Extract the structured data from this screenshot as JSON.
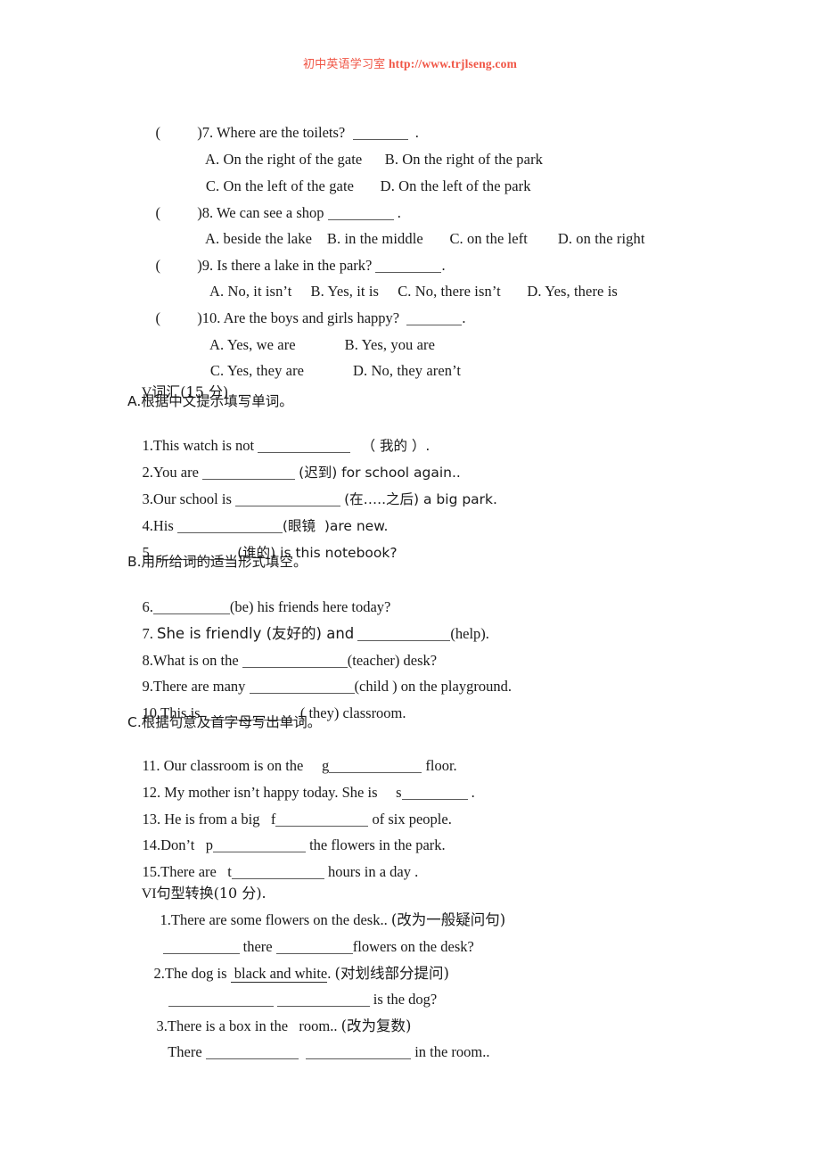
{
  "header": {
    "chinese": "初中英语学习室",
    "url": "http://www.trjlseng.com",
    "color": "#f05545"
  },
  "multiple_choice": [
    {
      "marker": "(          )7.",
      "stem": "Where are the toilets?",
      "options_rows": [
        [
          "A. On the right of the gate",
          "B. On the right of the park"
        ],
        [
          "C. On the left of the gate",
          "D. On the left of the park"
        ]
      ]
    },
    {
      "marker": "(          )8.",
      "stem": "We can see a shop",
      "options_rows": [
        [
          "A. beside the lake",
          "B. in the middle",
          "C. on the left",
          "D. on the right"
        ]
      ]
    },
    {
      "marker": "(          )9.",
      "stem": "Is there a lake in the park?",
      "options_rows": [
        [
          "A. No, it isn’t",
          "B. Yes, it is",
          "C. No, there isn’t",
          "D. Yes, there is"
        ]
      ]
    },
    {
      "marker": "(          )10.",
      "stem": "Are the boys and girls happy?",
      "options_rows": [
        [
          "A. Yes, we are",
          "B. Yes, you are"
        ],
        [
          "C. Yes, they are",
          "D. No, they aren’t"
        ]
      ]
    }
  ],
  "section_v": {
    "heading_roman": "V",
    "heading_cn": "词汇",
    "heading_score": "(15 分)",
    "part_a_heading": "A.根据中文提示填写单词。",
    "part_a_items": [
      {
        "num": "1.",
        "pre": "This watch is not",
        "post": "（ 我的 ）."
      },
      {
        "num": "2.",
        "pre": "You are",
        "post": "(迟到) for school again.."
      },
      {
        "num": "3.",
        "pre": "Our school is",
        "post": "(在…..之后) a big park."
      },
      {
        "num": "4.",
        "pre": "His",
        "post": "(眼镜  )are new."
      },
      {
        "num": "5.",
        "pre": "",
        "post": "(谁的) is this notebook?"
      }
    ],
    "part_b_heading": "B.用所给词的适当形式填空。",
    "part_b_items": [
      {
        "num": "6.",
        "pre": "",
        "post": "(be) his friends here today?"
      },
      {
        "num": "7.",
        "pre": "She is friendly (友好的) and",
        "post": "(help)."
      },
      {
        "num": "8.",
        "pre": "What is on the",
        "post": "(teacher) desk?"
      },
      {
        "num": "9.",
        "pre": "There are many",
        "post": "(child ) on the playground."
      },
      {
        "num": "10.",
        "pre": "This is",
        "post": "( they) classroom."
      }
    ],
    "part_c_heading": "C.根据句意及首字母写出单词。",
    "part_c_items": [
      {
        "num": "11.",
        "pre": "Our classroom is on the",
        "letter": "g",
        "post": "floor."
      },
      {
        "num": "12.",
        "pre": "My mother isn’t happy today. She is",
        "letter": "s",
        "post": "."
      },
      {
        "num": "13.",
        "pre": "He is from a big",
        "letter": "f",
        "post": "of six people."
      },
      {
        "num": "14.",
        "pre": "Don’t",
        "letter": "p",
        "post": "the flowers in the park."
      },
      {
        "num": "15.",
        "pre": "There are",
        "letter": "t",
        "post": "hours in a day ."
      }
    ]
  },
  "section_vi": {
    "heading_roman": "VI",
    "heading_cn": "句型转换",
    "heading_score": "(10 分).",
    "items": [
      {
        "num": "1.",
        "sentence": "There are some flowers on the desk..",
        "instruction": "(改为一般疑问句)",
        "answer_pre": "",
        "answer_mid": "there",
        "answer_post": "flowers on the desk?"
      },
      {
        "num": "2.",
        "sentence_pre": "The dog is",
        "underlined": " black and white",
        "sentence_post": ".",
        "instruction": "(对划线部分提问)",
        "answer_post": "is the dog?"
      },
      {
        "num": "3.",
        "sentence": "There is a box in the   room..",
        "instruction": "(改为复数)",
        "answer_pre": "There",
        "answer_post": "in the room.."
      }
    ]
  }
}
